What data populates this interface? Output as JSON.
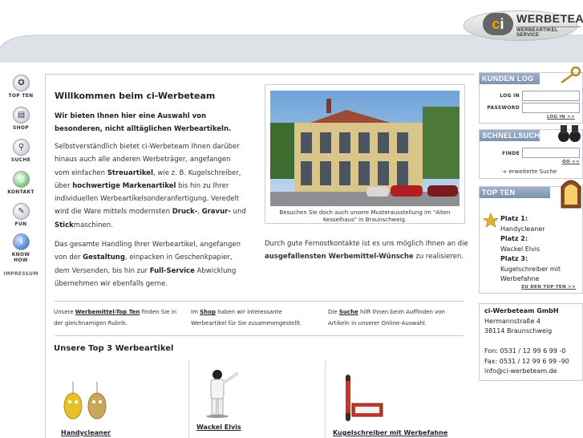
{
  "header": {
    "logo_ci": "ci",
    "logo_name": "WERBETEAM",
    "logo_sub": "WERBEARTIKEL SERVICE"
  },
  "leftnav": {
    "items": [
      {
        "label": "TOP TEN",
        "icon": "medal-icon",
        "glyph": "✪"
      },
      {
        "label": "SHOP",
        "icon": "cart-icon",
        "glyph": "▤"
      },
      {
        "label": "SUCHE",
        "icon": "magnifier-icon",
        "glyph": "⚲"
      },
      {
        "label": "KONTAKT",
        "icon": "contact-icon",
        "glyph": "@"
      },
      {
        "label": "FUN",
        "icon": "fun-icon",
        "glyph": "✎"
      },
      {
        "label": "KNOW HOW",
        "icon": "info-icon",
        "glyph": "i"
      },
      {
        "label": "IMPRESSUM",
        "icon": "",
        "glyph": ""
      }
    ]
  },
  "main": {
    "title": "Willkommen beim ci-Werbeteam",
    "intro": "Wir bieten Ihnen hier eine Auswahl von besonderen, nicht alltäglichen Werbeartikeln.",
    "para1": {
      "t1": "Selbstverständlich bietet ci-Werbeteam Ihnen darüber hinaus auch alle anderen Werbeträger, angefangen vom einfachen ",
      "b1": "Streuartikel",
      "t2": ", wie z. B. Kugelschreiber, über ",
      "b2": "hochwertige Markenartikel",
      "t3": " bis hin zu Ihrer individuellen Werbeartikelsonderanfertigung. Veredelt wird die Ware mittels modernsten ",
      "b3": "Druck-",
      "t4": ", ",
      "b4": "Gravur-",
      "t5": " und ",
      "b5": "Stick",
      "t6": "maschinen."
    },
    "para2": {
      "t1": "Das gesamte Handling Ihrer Werbeartikel, angefangen von der ",
      "b1": "Gestaltung",
      "t2": ", einpacken in Geschenkpapier, dem Versenden, bis hin zur ",
      "b2": "Full-Service",
      "t3": " Abwicklung übernehmen wir ebenfalls gerne."
    },
    "photo_caption": "Besuchen Sie doch auch unsere Musterausstellung im \"Alten Kesselhaus\" in Braunschweig.",
    "fernost": {
      "t1": "Durch gute Fernostkontakte ist es uns möglich Ihnen an die ",
      "b1": "ausgefallensten Werbemittel-Wünsche",
      "t2": " zu realisieren."
    },
    "cols": [
      {
        "pre": "Unsere ",
        "link": "Werbemittel-Top Ten",
        "post": " finden Sie in der gleichnamigen Rubrik."
      },
      {
        "pre": "Im ",
        "link": "Shop",
        "post": " haben wir interessante Werbeartikel für Sie zusammengestellt."
      },
      {
        "pre": "Die ",
        "link": "Suche",
        "post": " hilft Ihnen beim Auffinden von Artikeln in unserer Online-Auswahl."
      }
    ],
    "top3_title": "Unsere Top 3 Werbeartikel",
    "products": [
      "Handycleaner",
      "Wackel Elvis",
      "Kugelschreiber mit Werbefahne"
    ]
  },
  "right": {
    "login": {
      "title": "KUNDEN LOG IN",
      "log_in_label": "LOG IN",
      "password_label": "PASSWORD",
      "button": "LOG IN >>"
    },
    "search": {
      "title": "SCHNELLSUCHE",
      "finde_label": "FINDE",
      "button": "OO >>",
      "extended": "erweiterte Suche"
    },
    "topten": {
      "title": "TOP TEN",
      "p1": "Platz 1:",
      "i1": "Handycleaner",
      "p2": "Platz 2:",
      "i2": "Wackel Elvis",
      "p3": "Platz 3:",
      "i3": "Kugelschreiber mit Werbefahne",
      "more": "ZU DEN TOP TEN >>"
    },
    "contact": {
      "company": "ci-Werbeteam GmbH",
      "street": "Hermannstraße 4",
      "city": "38114 Braunschweig",
      "fon": "Fon: 0531 / 12 99 6 99 -0",
      "fax": "Fax: 0531 / 12 99 6 99 -90",
      "email": "info@ci-werbeteam.de"
    }
  }
}
